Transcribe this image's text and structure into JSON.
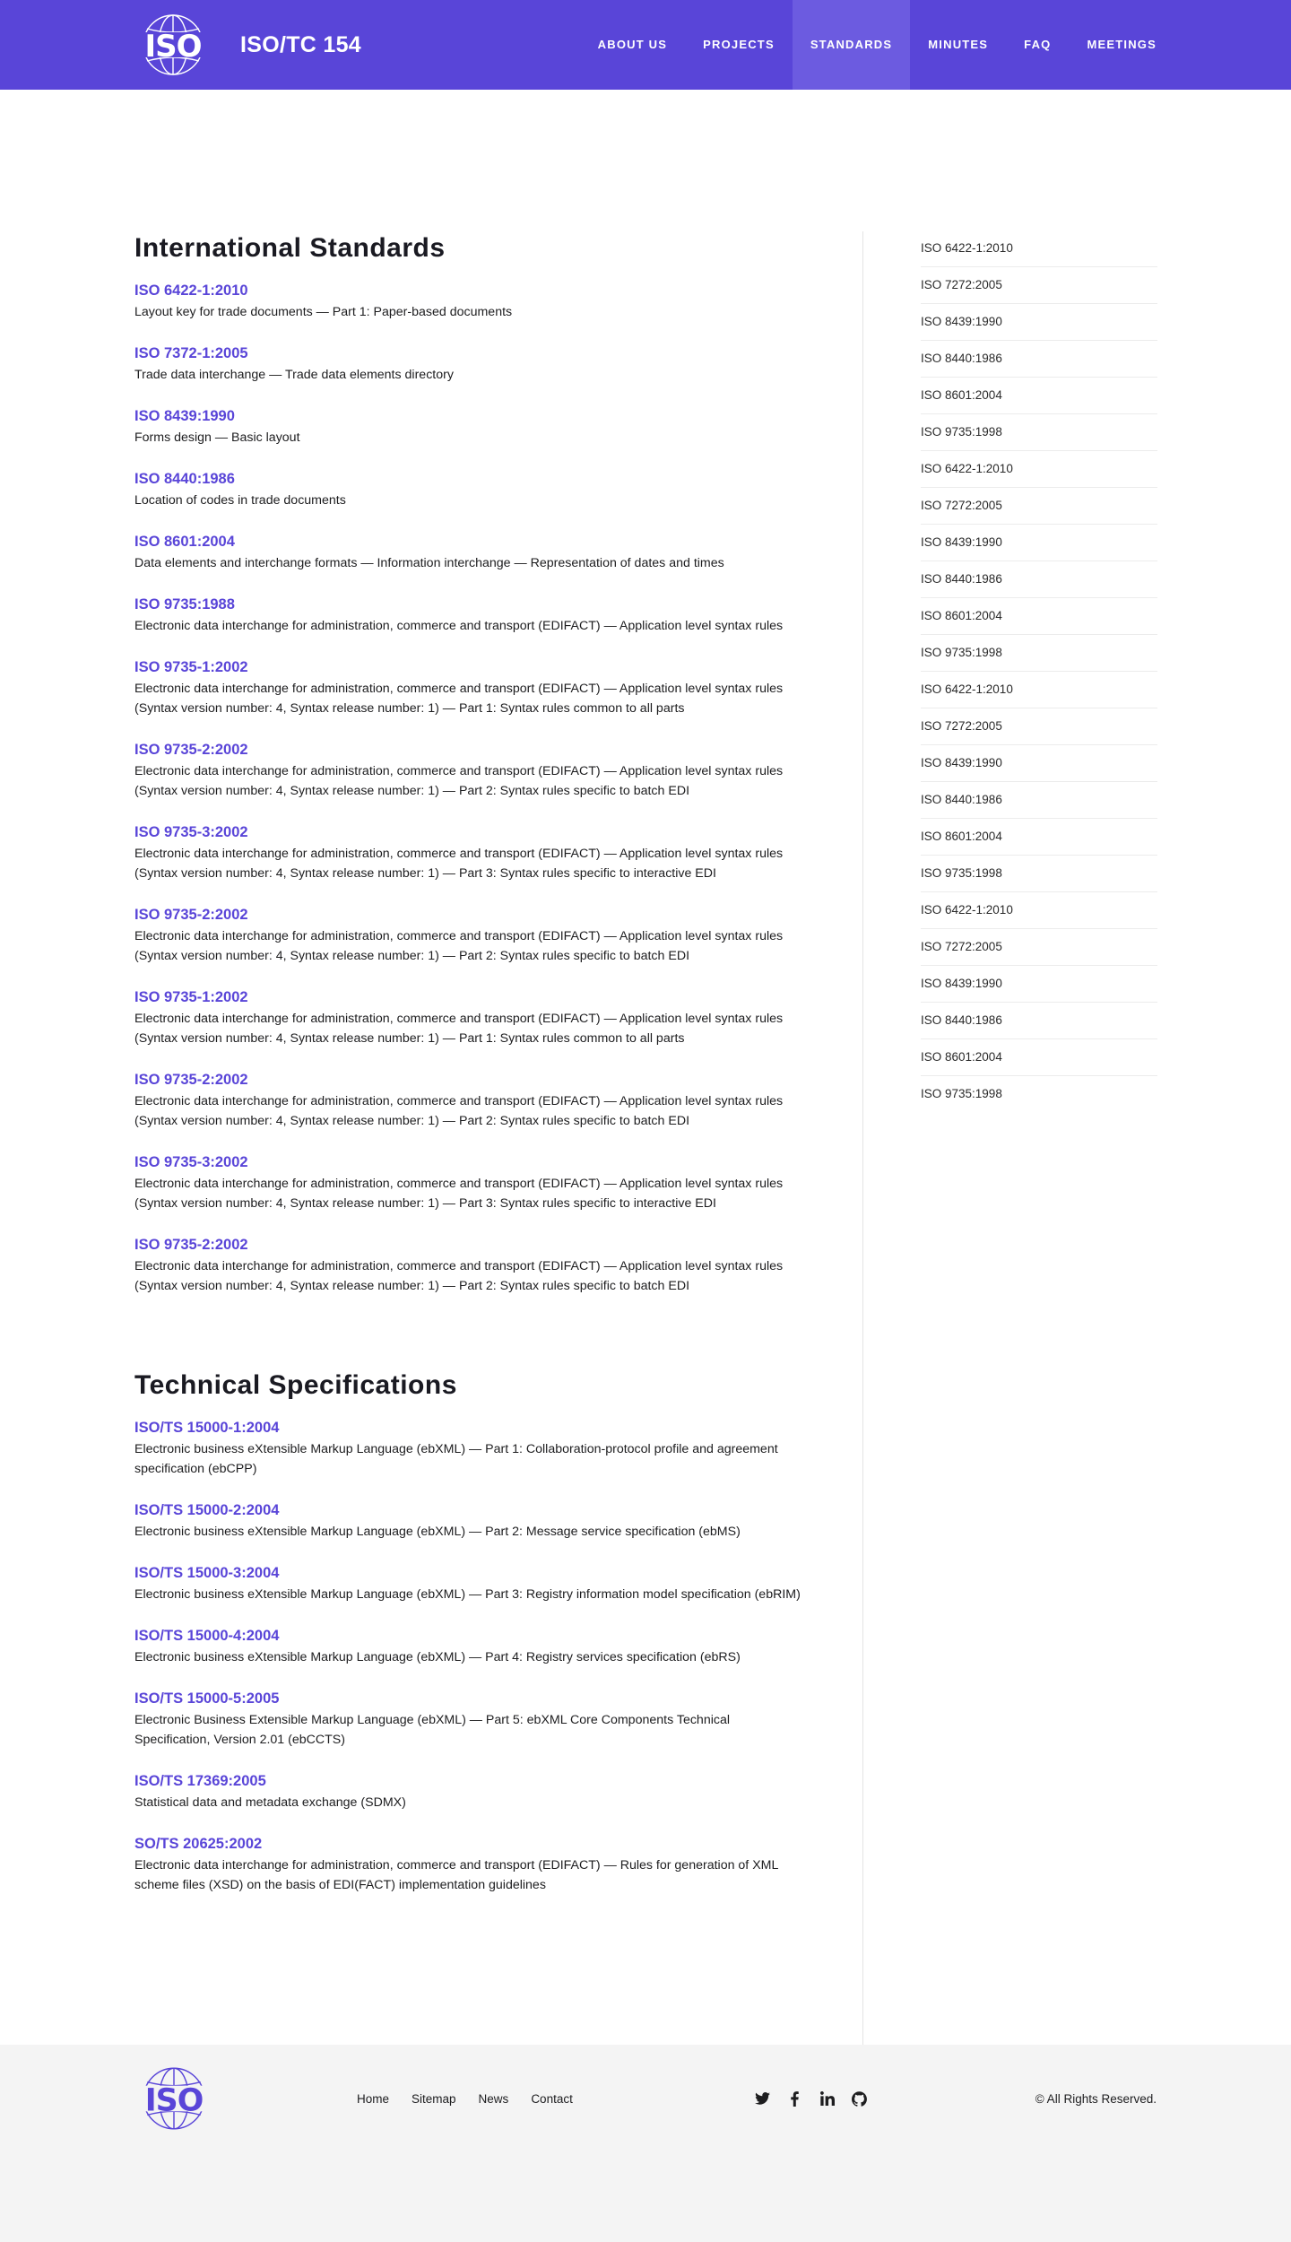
{
  "header": {
    "site_title": "ISO/TC 154",
    "logo_text": "ISO",
    "nav": [
      {
        "label": "About us"
      },
      {
        "label": "Projects"
      },
      {
        "label": "Standards"
      },
      {
        "label": "Minutes"
      },
      {
        "label": "FAQ"
      },
      {
        "label": "Meetings"
      }
    ],
    "active_nav": "Standards"
  },
  "international": {
    "title": "International Standards",
    "items": [
      {
        "code": "ISO 6422-1:2010",
        "desc": "Layout key for trade documents — Part 1: Paper-based documents"
      },
      {
        "code": "ISO 7372-1:2005",
        "desc": "Trade data interchange — Trade data elements directory"
      },
      {
        "code": "ISO 8439:1990",
        "desc": "Forms design — Basic layout"
      },
      {
        "code": "ISO 8440:1986",
        "desc": "Location of codes in trade documents"
      },
      {
        "code": "ISO 8601:2004",
        "desc": "Data elements and interchange formats — Information interchange — Representation of dates and times"
      },
      {
        "code": "ISO 9735:1988",
        "desc": "Electronic data interchange for administration, commerce and transport (EDIFACT) — Application level syntax rules"
      },
      {
        "code": "ISO 9735-1:2002",
        "desc": "Electronic data interchange for administration, commerce and transport (EDIFACT) — Application level syntax rules (Syntax version number: 4, Syntax release number: 1) — Part 1: Syntax rules common to all parts"
      },
      {
        "code": "ISO 9735-2:2002",
        "desc": "Electronic data interchange for administration, commerce and transport (EDIFACT) — Application level syntax rules (Syntax version number: 4, Syntax release number: 1) — Part 2: Syntax rules specific to batch EDI"
      },
      {
        "code": "ISO 9735-3:2002",
        "desc": "Electronic data interchange for administration, commerce and transport (EDIFACT) — Application level syntax rules (Syntax version number: 4, Syntax release number: 1) — Part 3: Syntax rules specific to interactive EDI"
      },
      {
        "code": "ISO 9735-2:2002",
        "desc": "Electronic data interchange for administration, commerce and transport (EDIFACT) — Application level syntax rules (Syntax version number: 4, Syntax release number: 1) — Part 2: Syntax rules specific to batch EDI"
      },
      {
        "code": "ISO 9735-1:2002",
        "desc": "Electronic data interchange for administration, commerce and transport (EDIFACT) — Application level syntax rules (Syntax version number: 4, Syntax release number: 1) — Part 1: Syntax rules common to all parts"
      },
      {
        "code": "ISO 9735-2:2002",
        "desc": "Electronic data interchange for administration, commerce and transport (EDIFACT) — Application level syntax rules (Syntax version number: 4, Syntax release number: 1) — Part 2: Syntax rules specific to batch EDI"
      },
      {
        "code": "ISO 9735-3:2002",
        "desc": "Electronic data interchange for administration, commerce and transport (EDIFACT) — Application level syntax rules (Syntax version number: 4, Syntax release number: 1) — Part 3: Syntax rules specific to interactive EDI"
      },
      {
        "code": "ISO 9735-2:2002",
        "desc": "Electronic data interchange for administration, commerce and transport (EDIFACT) — Application level syntax rules (Syntax version number: 4, Syntax release number: 1) — Part 2: Syntax rules specific to batch EDI"
      }
    ]
  },
  "technical": {
    "title": "Technical Specifications",
    "items": [
      {
        "code": "ISO/TS 15000-1:2004",
        "desc": "Electronic business eXtensible Markup Language (ebXML) — Part 1: Collaboration-protocol profile and agreement specification (ebCPP)"
      },
      {
        "code": "ISO/TS 15000-2:2004",
        "desc": "Electronic business eXtensible Markup Language (ebXML) — Part 2: Message service specification (ebMS)"
      },
      {
        "code": "ISO/TS 15000-3:2004",
        "desc": "Electronic business eXtensible Markup Language (ebXML) — Part 3: Registry information model specification (ebRIM)"
      },
      {
        "code": "ISO/TS 15000-4:2004",
        "desc": "Electronic business eXtensible Markup Language (ebXML) — Part 4: Registry services specification (ebRS)"
      },
      {
        "code": "ISO/TS 15000-5:2005",
        "desc": "Electronic Business Extensible Markup Language (ebXML) — Part 5: ebXML Core Components Technical Specification, Version 2.01 (ebCCTS)"
      },
      {
        "code": "ISO/TS 17369:2005",
        "desc": "Statistical data and metadata exchange (SDMX)"
      },
      {
        "code": "SO/TS 20625:2002",
        "desc": "Electronic data interchange for administration, commerce and transport (EDIFACT) — Rules for generation of XML scheme files (XSD) on the basis of EDI(FACT) implementation guidelines"
      }
    ]
  },
  "sidebar": {
    "items": [
      "ISO 6422-1:2010",
      "ISO 7272:2005",
      "ISO 8439:1990",
      "ISO 8440:1986",
      "ISO 8601:2004",
      "ISO 9735:1998",
      "ISO 6422-1:2010",
      "ISO 7272:2005",
      "ISO 8439:1990",
      "ISO 8440:1986",
      "ISO 8601:2004",
      "ISO 9735:1998",
      "ISO 6422-1:2010",
      "ISO 7272:2005",
      "ISO 8439:1990",
      "ISO 8440:1986",
      "ISO 8601:2004",
      "ISO 9735:1998",
      "ISO 6422-1:2010",
      "ISO 7272:2005",
      "ISO 8439:1990",
      "ISO 8440:1986",
      "ISO 8601:2004",
      "ISO 9735:1998"
    ]
  },
  "footer": {
    "logo_text": "ISO",
    "links": [
      "Home",
      "Sitemap",
      "News",
      "Contact"
    ],
    "social": [
      {
        "icon": "twitter-icon"
      },
      {
        "icon": "facebook-icon"
      },
      {
        "icon": "linkedin-icon"
      },
      {
        "icon": "github-icon"
      }
    ],
    "copyright": "© All Rights Reserved."
  },
  "colors": {
    "brand": "#5945d8",
    "nav_active": "#6c5be0",
    "footer_bg": "#f4f4f4"
  }
}
